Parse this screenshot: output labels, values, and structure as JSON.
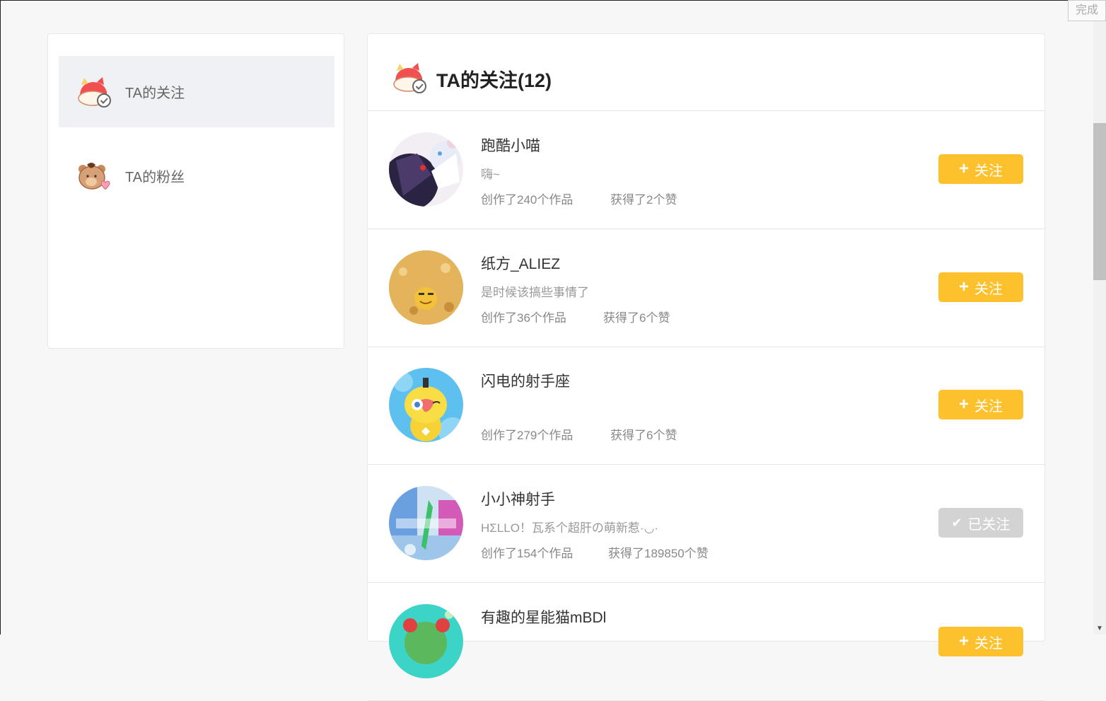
{
  "sidebar": {
    "items": [
      {
        "label": "TA的关注",
        "icon": "cat-follow-icon",
        "active": true
      },
      {
        "label": "TA的粉丝",
        "icon": "bear-heart-icon",
        "active": false
      }
    ]
  },
  "main": {
    "title": "TA的关注(12)",
    "users": [
      {
        "name": "跑酷小喵",
        "bio": "嗨~",
        "works": "创作了240个作品",
        "likes": "获得了2个赞",
        "button": "关注",
        "followed": false
      },
      {
        "name": "纸方_ALIEZ",
        "bio": "是时候该搞些事情了",
        "works": "创作了36个作品",
        "likes": "获得了6个赞",
        "button": "关注",
        "followed": false
      },
      {
        "name": "闪电的射手座",
        "bio": "",
        "works": "创作了279个作品",
        "likes": "获得了6个赞",
        "button": "关注",
        "followed": false
      },
      {
        "name": "小小神射手",
        "bio": "HΣLLO！瓦系个超肝の萌新惹·◡·",
        "works": "创作了154个作品",
        "likes": "获得了189850个赞",
        "button": "已关注",
        "followed": true
      },
      {
        "name": "有趣的星能猫mBDl",
        "bio": "",
        "works": "",
        "likes": "",
        "button": "关注",
        "followed": false
      }
    ]
  },
  "overlay": {
    "done_label": "完成"
  },
  "colors": {
    "follow": "#fdc12d",
    "followed": "#d3d3d3",
    "active_bg": "#eff1f4"
  }
}
